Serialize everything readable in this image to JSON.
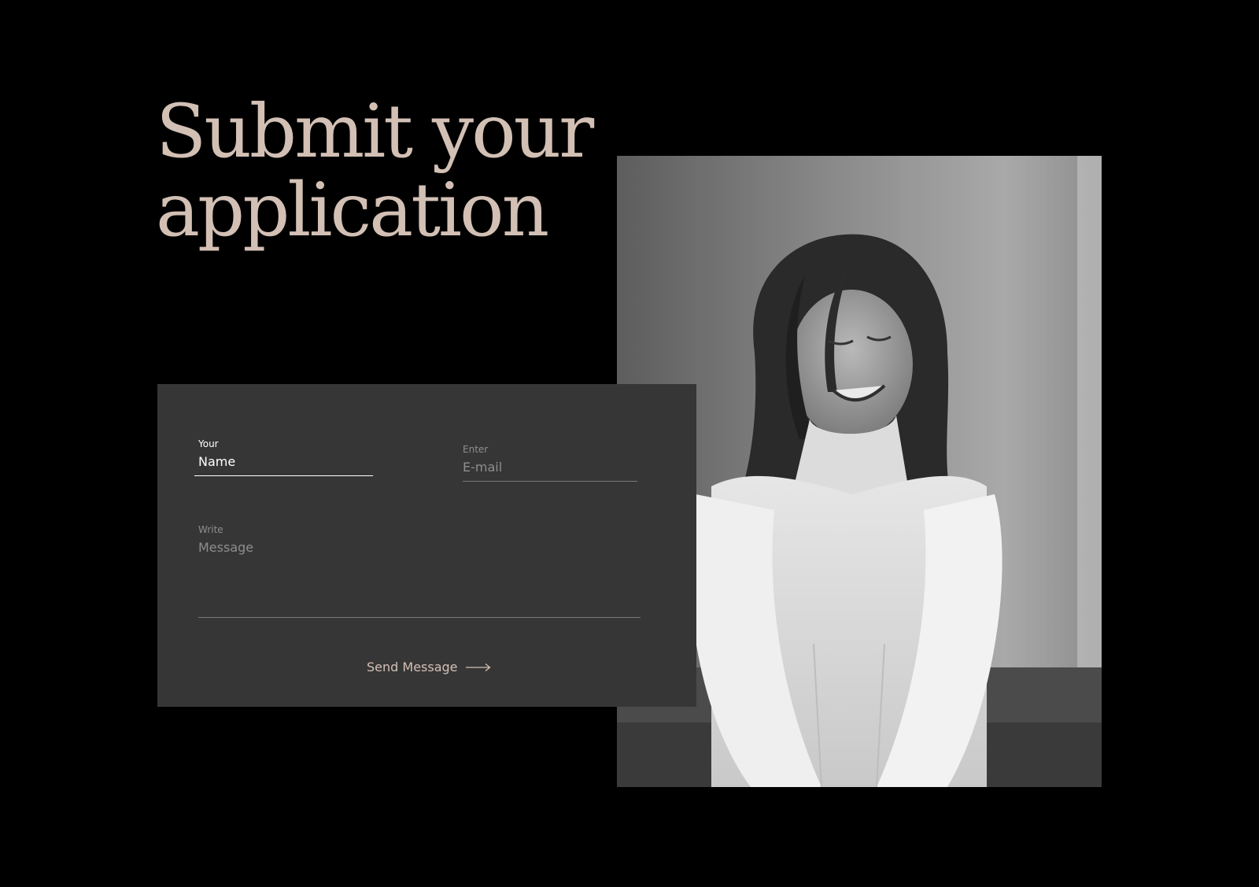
{
  "heading": {
    "line1": "Submit your",
    "line2": "application"
  },
  "form": {
    "name_label": "Your",
    "name_value": "Name",
    "email_label": "Enter",
    "email_placeholder": "E-mail",
    "message_label": "Write",
    "message_placeholder": "Message",
    "send_label": "Send Message"
  },
  "colors": {
    "background": "#000000",
    "accent": "#d3c0b5",
    "card": "#363636"
  },
  "icons": {
    "send": "arrow-right-icon"
  }
}
